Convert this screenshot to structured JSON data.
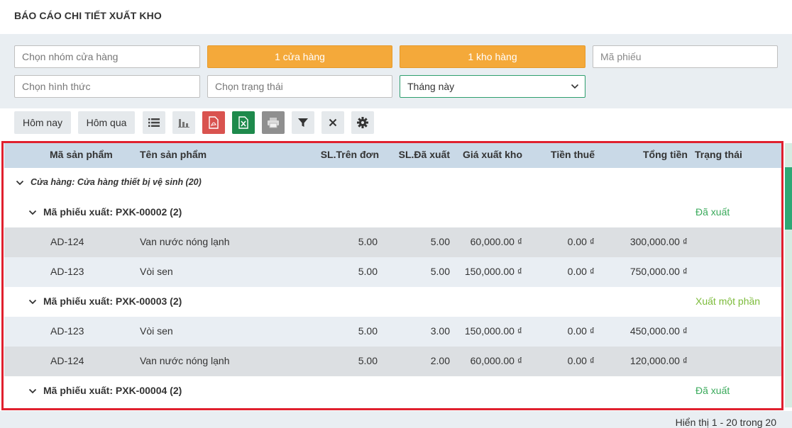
{
  "page": {
    "title": "BÁO CÁO CHI TIẾT XUẤT KHO"
  },
  "filters": {
    "store_group": {
      "placeholder": "Chọn nhóm cửa hàng"
    },
    "store": {
      "value": "1 cửa hàng"
    },
    "warehouse": {
      "value": "1 kho hàng"
    },
    "voucher_code": {
      "placeholder": "Mã phiếu"
    },
    "form": {
      "placeholder": "Chọn hình thức"
    },
    "status": {
      "placeholder": "Chọn trạng thái"
    },
    "period": {
      "value": "Tháng này"
    }
  },
  "toolbar": {
    "today_label": "Hôm nay",
    "yesterday_label": "Hôm qua",
    "icons": [
      "list-icon",
      "chart-icon",
      "pdf-icon",
      "excel-icon",
      "print-icon",
      "filter-icon",
      "close-icon",
      "gear-icon"
    ],
    "colors": {
      "pdf": "#d9534f",
      "excel": "#1e8a4c",
      "print": "#8f8f8f",
      "accent_orange": "#f4a93a",
      "status_green": "#3aaa5b"
    }
  },
  "table": {
    "columns": [
      "Mã sản phẩm",
      "Tên sản phẩm",
      "SL.Trên đơn",
      "SL.Đã xuất",
      "Giá xuất kho",
      "Tiền thuế",
      "Tổng tiền",
      "Trạng thái"
    ],
    "store_group": "Cửa hàng: Cửa hàng thiết bị vệ sinh (20)",
    "groups": [
      {
        "label": "Mã phiếu xuất: PXK-00002 (2)",
        "status": "Đã xuất",
        "rows": [
          {
            "code": "AD-124",
            "name": "Van nước nóng lạnh",
            "qty_order": "5.00",
            "qty_out": "5.00",
            "price": "60,000.00 ₫",
            "tax": "0.00 ₫",
            "total": "300,000.00 ₫"
          },
          {
            "code": "AD-123",
            "name": "Vòi sen",
            "qty_order": "5.00",
            "qty_out": "5.00",
            "price": "150,000.00 ₫",
            "tax": "0.00 ₫",
            "total": "750,000.00 ₫"
          }
        ]
      },
      {
        "label": "Mã phiếu xuất: PXK-00003 (2)",
        "status": "Xuất một phần",
        "rows": [
          {
            "code": "AD-123",
            "name": "Vòi sen",
            "qty_order": "5.00",
            "qty_out": "3.00",
            "price": "150,000.00 ₫",
            "tax": "0.00 ₫",
            "total": "450,000.00 ₫"
          },
          {
            "code": "AD-124",
            "name": "Van nước nóng lạnh",
            "qty_order": "5.00",
            "qty_out": "2.00",
            "price": "60,000.00 ₫",
            "tax": "0.00 ₫",
            "total": "120,000.00 ₫"
          }
        ]
      },
      {
        "label": "Mã phiếu xuất: PXK-00004 (2)",
        "status": "Đã xuất",
        "rows": []
      }
    ]
  },
  "footer": {
    "paging": "Hiển thị 1 - 20 trong 20"
  }
}
